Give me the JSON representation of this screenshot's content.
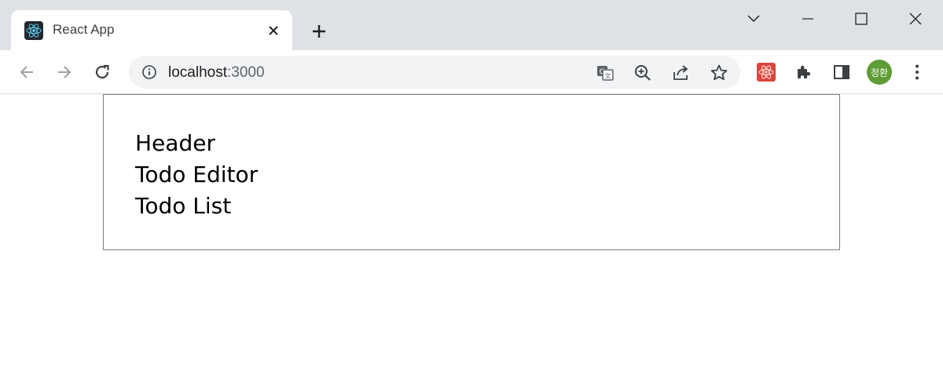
{
  "browser": {
    "tab": {
      "title": "React App",
      "favicon": "react-logo-icon"
    },
    "new_tab_icon": "plus-icon",
    "window_controls": [
      "tab-search-icon",
      "minimize-icon",
      "maximize-icon",
      "close-window-icon"
    ],
    "nav": [
      "back-arrow-icon",
      "forward-arrow-icon",
      "reload-icon"
    ],
    "address": {
      "host": "localhost",
      "port": ":3000"
    },
    "omnibox_actions": [
      "translate-icon",
      "zoom-icon",
      "share-icon",
      "bookmark-star-icon"
    ],
    "extensions": [
      "react-devtools-icon",
      "puzzle-extensions-icon",
      "side-panel-icon"
    ],
    "profile": {
      "initials": "정환",
      "color": "#5e9c36"
    }
  },
  "page": {
    "lines": [
      "Header",
      "Todo Editor",
      "Todo List"
    ]
  },
  "colors": {
    "tabbar_bg": "#dee1e6",
    "omnibox_bg": "#f1f3f4",
    "box_border": "#808080"
  }
}
